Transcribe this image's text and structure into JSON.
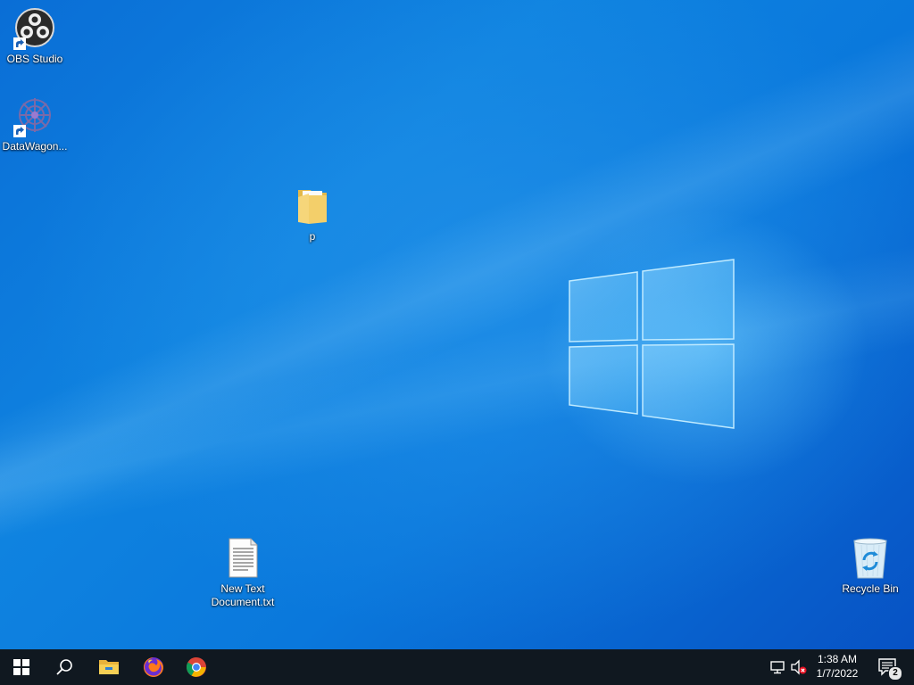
{
  "desktop": {
    "icons": [
      {
        "label": "OBS Studio",
        "icon": "obs-studio-icon",
        "shortcut": true
      },
      {
        "label": "DataWagon...",
        "icon": "datawagon-icon",
        "shortcut": true
      },
      {
        "label": "p",
        "icon": "folder-icon",
        "shortcut": false
      },
      {
        "label": "New Text Document.txt",
        "icon": "text-document-icon",
        "shortcut": false
      },
      {
        "label": "Recycle Bin",
        "icon": "recycle-bin-icon",
        "shortcut": false
      }
    ]
  },
  "taskbar": {
    "start": {
      "icon": "windows-start-icon"
    },
    "search": {
      "icon": "search-icon"
    },
    "pinned": [
      {
        "name": "File Explorer",
        "icon": "file-explorer-icon"
      },
      {
        "name": "Firefox",
        "icon": "firefox-icon"
      },
      {
        "name": "Chrome",
        "icon": "chrome-icon"
      }
    ],
    "tray": {
      "network_icon": "network-disconnected-icon",
      "volume_icon": "volume-muted-icon",
      "time": "1:38 AM",
      "date": "1/7/2022",
      "notifications_count": "2"
    }
  },
  "colors": {
    "taskbar_bg": "#101820",
    "wallpaper_blue": "#0a78dc"
  }
}
